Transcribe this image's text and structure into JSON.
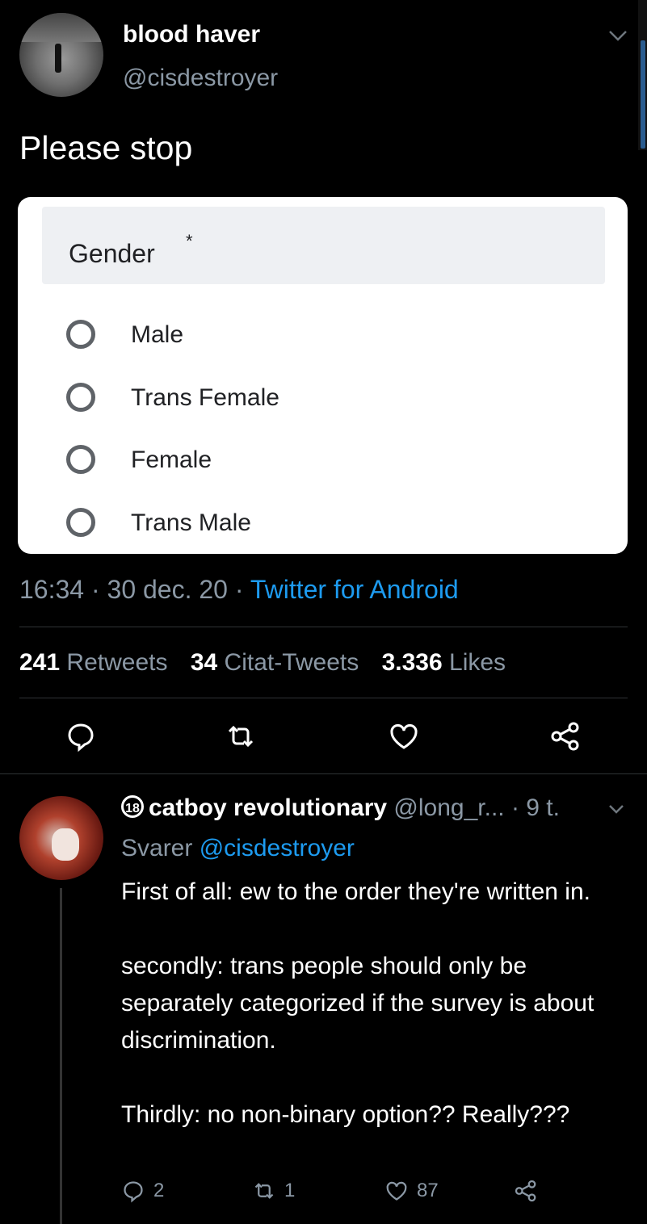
{
  "tweet": {
    "author_name": "blood haver",
    "author_handle": "@cisdestroyer",
    "text": "Please stop",
    "timestamp": "16:34 · 30 dec. 20 · ",
    "source": "Twitter for Android",
    "stats": {
      "retweets_count": "241",
      "retweets_label": "Retweets",
      "quotes_count": "34",
      "quotes_label": "Citat-Tweets",
      "likes_count": "3.336",
      "likes_label": "Likes"
    }
  },
  "form": {
    "label": "Gender",
    "required_mark": "*",
    "options": [
      "Male",
      "Trans Female",
      "Female",
      "Trans Male"
    ]
  },
  "reply": {
    "badge": "18",
    "author_name": "catboy revolutionary",
    "author_handle_time": " @long_r... · 9 t.",
    "replying_to_label": "Svarer ",
    "replying_to_handle": "@cisdestroyer",
    "paragraphs": [
      "First of all: ew to the order they're written in.",
      "secondly: trans people should only be separately categorized if the survey is about discrimination.",
      "Thirdly: no non-binary option?? Really???"
    ],
    "reply_count": "2",
    "retweet_count": "1",
    "like_count": "87"
  },
  "icons": {
    "reply": "reply-icon",
    "retweet": "retweet-icon",
    "like": "heart-icon",
    "share": "share-icon",
    "caret": "chevron-down-icon"
  },
  "colors": {
    "background": "#000000",
    "accent": "#1d9bf0",
    "secondary_text": "#8b98a5"
  }
}
